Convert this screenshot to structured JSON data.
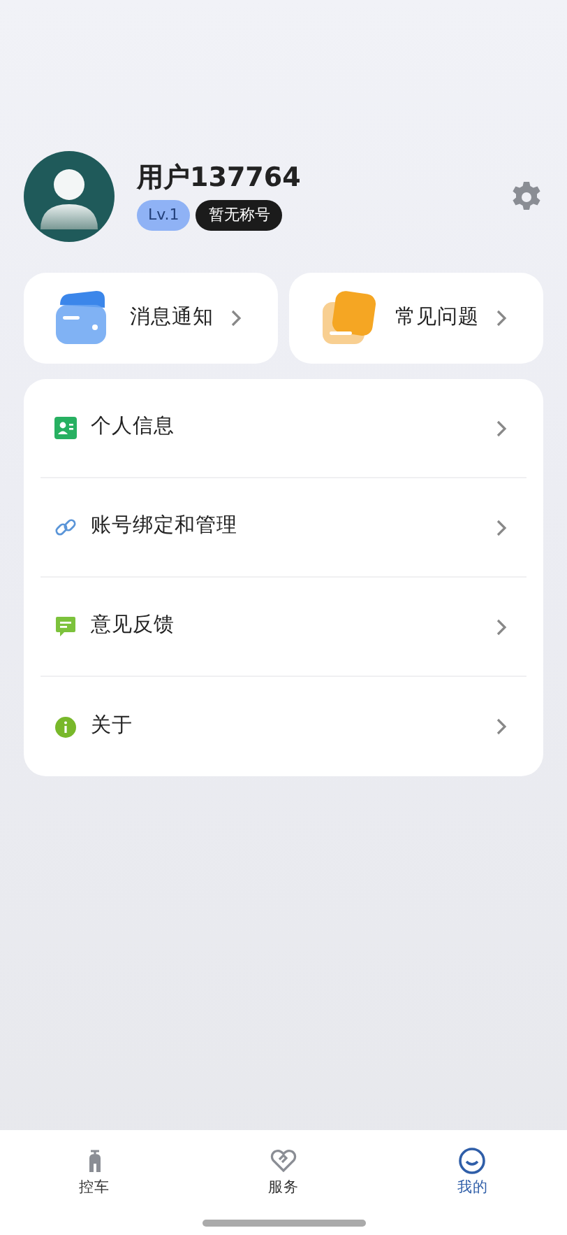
{
  "profile": {
    "username": "用户137764",
    "level_badge": "Lv.1",
    "title_badge": "暂无称号"
  },
  "shortcuts": [
    {
      "kind": "message",
      "label": "消息通知"
    },
    {
      "kind": "faq",
      "label": "常见问题"
    }
  ],
  "menu": [
    {
      "kind": "profile",
      "label": "个人信息"
    },
    {
      "kind": "link",
      "label": "账号绑定和管理"
    },
    {
      "kind": "feedback",
      "label": "意见反馈"
    },
    {
      "kind": "info",
      "label": "关于"
    }
  ],
  "tab_bar": [
    {
      "kind": "scooter",
      "label": "控车",
      "selected": false
    },
    {
      "kind": "service",
      "label": "服务",
      "selected": false
    },
    {
      "kind": "me",
      "label": "我的",
      "selected": true
    }
  ]
}
